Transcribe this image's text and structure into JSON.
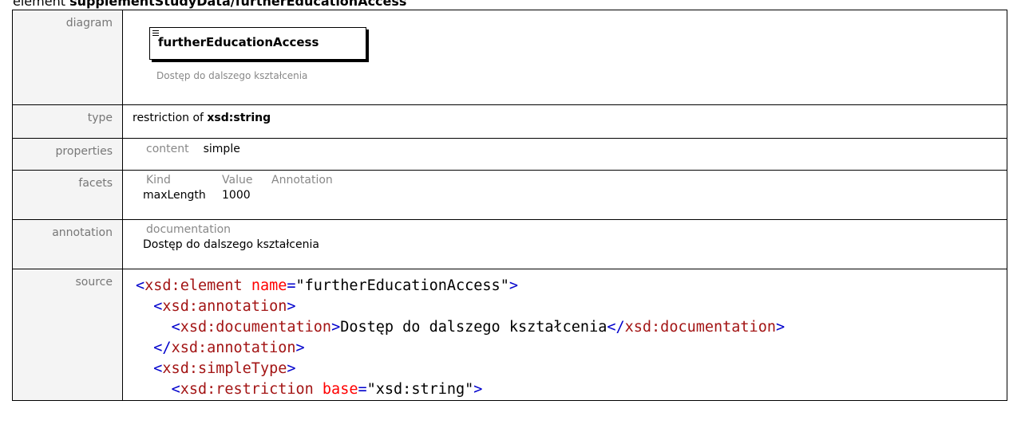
{
  "heading": {
    "prefix": "element ",
    "path": "supplementStudyData/furtherEducationAccess"
  },
  "labels": {
    "diagram": "diagram",
    "type": "type",
    "properties": "properties",
    "facets": "facets",
    "annotation": "annotation",
    "source": "source"
  },
  "diagram": {
    "element_name": "furtherEducationAccess",
    "documentation": "Dostęp do dalszego kształcenia"
  },
  "type": {
    "prefix": "restriction of ",
    "base": "xsd:string"
  },
  "properties": {
    "key": "content",
    "value": "simple"
  },
  "facets": {
    "headers": [
      "Kind",
      "Value",
      "Annotation"
    ],
    "rows": [
      {
        "kind": "maxLength",
        "value": "1000",
        "annotation": ""
      }
    ]
  },
  "annotation": {
    "header": "documentation",
    "text": "Dostęp do dalszego kształcenia"
  },
  "source": {
    "line1_tag": "xsd:element",
    "line1_attr": "name",
    "line1_val": "\"furtherEducationAccess\"",
    "line2_tag": "xsd:annotation",
    "line3_tag": "xsd:documentation",
    "line3_text": "Dostęp do dalszego kształcenia",
    "line3_close": "xsd:documentation",
    "line4_tag": "xsd:annotation",
    "line5_tag": "xsd:simpleType",
    "line6_tag": "xsd:restriction",
    "line6_attr": "base",
    "line6_val": "\"xsd:string\""
  }
}
